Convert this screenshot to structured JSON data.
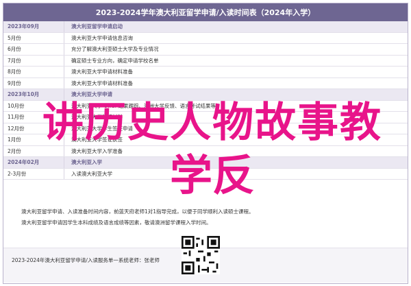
{
  "header": {
    "title": "2023-2024学年澳大利亚留学申请/入读时间表（2024年入学）"
  },
  "rows": [
    {
      "type": "section",
      "date": "2023年09月",
      "desc": "澳大利亚留学申请启动"
    },
    {
      "type": "row",
      "date": "5月份",
      "desc": "澳大利亚大学申请信息咨询"
    },
    {
      "type": "row",
      "date": "6月份",
      "desc": "充分了解澳大利亚硕士大学及专业情况"
    },
    {
      "type": "row",
      "date": "7月份",
      "desc": "确定硕士专业方向，确定申请学校名单"
    },
    {
      "type": "row",
      "date": "8月份",
      "desc": "澳大利亚大学申请材料准备"
    },
    {
      "type": "row",
      "date": "9月份",
      "desc": "澳大利亚大学申请材料准备"
    },
    {
      "type": "section",
      "date": "2023年10月",
      "desc": "澳大利亚大学申请"
    },
    {
      "type": "row",
      "date": "10月份",
      "desc": "澳大利亚大学 Offer 结果跟踪、澳洲大学反馈、语言考试结果等"
    },
    {
      "type": "row",
      "date": "11月份",
      "desc": "澳大利亚大学签证材料"
    },
    {
      "type": "row",
      "date": "12月份",
      "desc": "澳大利亚大学学生签证申请"
    },
    {
      "type": "row",
      "date": "1月份",
      "desc": "澳大利亚大学签证获签"
    },
    {
      "type": "row",
      "date": "2月份",
      "desc": "澳大利亚大学入学准备"
    },
    {
      "type": "section",
      "date": "2024年02月",
      "desc": "澳大利亚入学"
    },
    {
      "type": "row",
      "date": "2-3月份",
      "desc": "入读澳大利亚大学"
    }
  ],
  "notes": [
    "澳大利亚留学申请、入读准备时间内容，前蓝天府老师1对1指导完成，以便于同学顺利入读硕士课程。",
    "澳大利亚留学申请因学生本科成绩及语言成绩等因素，敬请澳洲留学课程入学时间。"
  ],
  "footer": {
    "text": "2023-2024年澳大利亚留学申请/入读服务单一系统老师：张老师"
  },
  "overlay": {
    "line1": "讲历史人物故事教",
    "line2": "学反",
    "color": "#e8148a"
  }
}
